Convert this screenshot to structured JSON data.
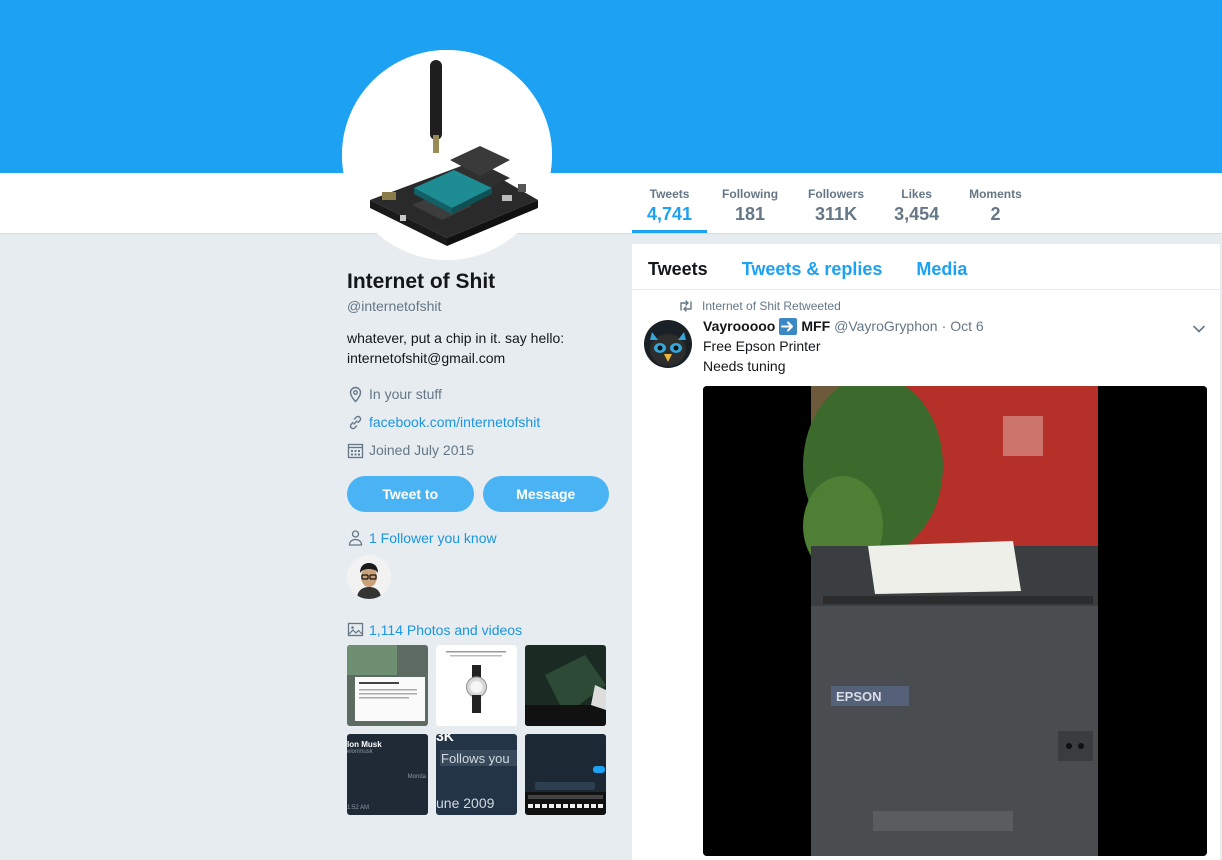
{
  "colors": {
    "brand": "#1da1f2",
    "link": "#1b95e0",
    "button": "#4ab3f4",
    "muted": "#657786"
  },
  "stats": [
    {
      "label": "Tweets",
      "value": "4,741"
    },
    {
      "label": "Following",
      "value": "181"
    },
    {
      "label": "Followers",
      "value": "311K"
    },
    {
      "label": "Likes",
      "value": "3,454"
    },
    {
      "label": "Moments",
      "value": "2"
    }
  ],
  "profile": {
    "name": "Internet of Shit",
    "handle": "@internetofshit",
    "bio_line1": "whatever, put a chip in it. say hello:",
    "bio_line2": "internetofshit@gmail.com",
    "location": "In your stuff",
    "website": "facebook.com/internetofshit",
    "joined": "Joined July 2015",
    "tweet_to_label": "Tweet to",
    "message_label": "Message",
    "followers_you_know": "1 Follower you know",
    "photos_videos": "1,114 Photos and videos"
  },
  "thumbs": {
    "t5_text": "Follows you",
    "t5_date": "une 2009",
    "t4_name": "lon Musk",
    "t4_handle": "elonmusk",
    "t4_time": "1:52 AM",
    "t4_day": "Monda",
    "t5_top": "3K"
  },
  "timeline": {
    "tabs": [
      "Tweets",
      "Tweets & replies",
      "Media"
    ],
    "tweet": {
      "retweeted_by": "Internet of Shit Retweeted",
      "name": "Vayrooooo",
      "name2": "MFF",
      "handle": "@VayroGryphon",
      "dot": "·",
      "date": "Oct 6",
      "line1": "Free Epson Printer",
      "line2": "Needs tuning",
      "media_brand": "EPSON"
    }
  },
  "icons": [
    "location-icon",
    "link-icon",
    "calendar-icon",
    "person-icon",
    "image-icon",
    "retweet-icon",
    "chevron-down-icon"
  ]
}
